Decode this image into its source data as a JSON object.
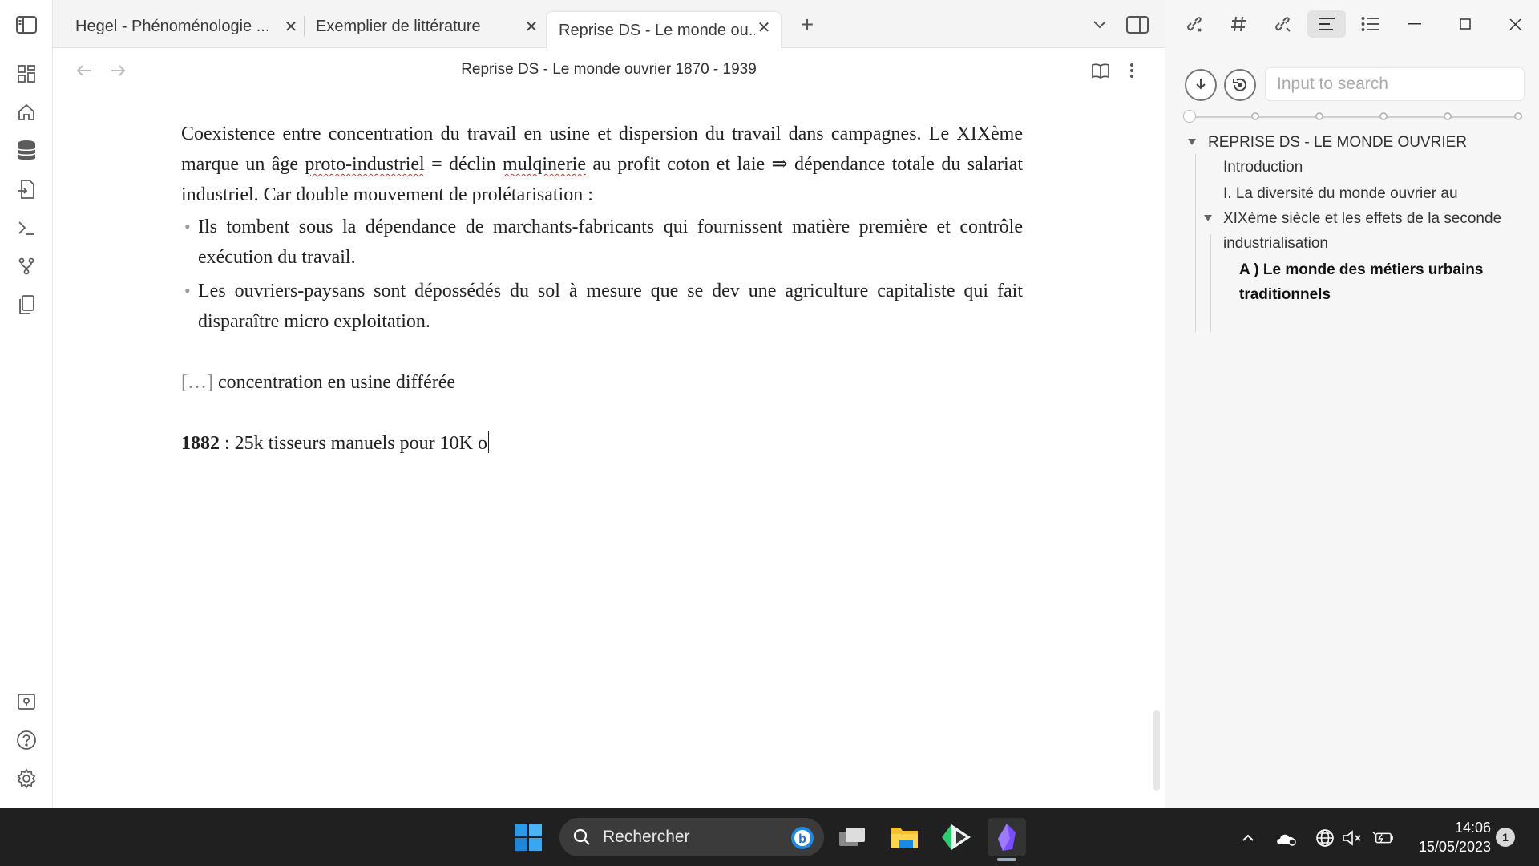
{
  "tabs": [
    {
      "label": "Hegel - Phénoménologie ..."
    },
    {
      "label": "Exemplier de littérature"
    },
    {
      "label": "Reprise DS - Le monde ou..."
    }
  ],
  "view": {
    "title": "Reprise DS - Le monde ouvrier 1870 - 1939"
  },
  "content": {
    "para1_a": "Coexistence entre concentration du travail en usine et dispersion du travail dans campagnes. Le XIXème marque un âge ",
    "para1_misspelled1": "proto-industriel",
    "para1_b": " = déclin ",
    "para1_misspelled2": "mulqinerie",
    "para1_c": " au profit coton et laie ⇒ dépendance totale du salariat industriel. Car double mouvement de prolétarisation :",
    "bullets": [
      "Ils tombent sous la dépendance de marchants-fabricants qui fournissent matière première et contrôle exécution du travail.",
      "Les ouvriers-paysans sont dépossédés du sol à mesure que se dev une agriculture capitaliste qui fait disparaître micro exploitation."
    ],
    "ellipsis": "[…]",
    "line2": " concentration en usine différée",
    "line3_bold": "1882",
    "line3": " : 25k tisseurs manuels pour 10K o"
  },
  "sidebar": {
    "search_placeholder": "Input to search",
    "outline": [
      {
        "text": "REPRISE DS - LE MONDE OUVRIER"
      },
      {
        "text": "Introduction"
      },
      {
        "text": "I. La diversité du monde ouvrier au"
      },
      {
        "text": "XIXème siècle et les effets de la seconde"
      },
      {
        "text": "industrialisation"
      },
      {
        "text": "A ) Le monde des métiers urbains"
      },
      {
        "text": "traditionnels"
      }
    ]
  },
  "taskbar": {
    "search_label": "Rechercher",
    "time": "14:06",
    "date": "15/05/2023",
    "notif_count": "1"
  }
}
